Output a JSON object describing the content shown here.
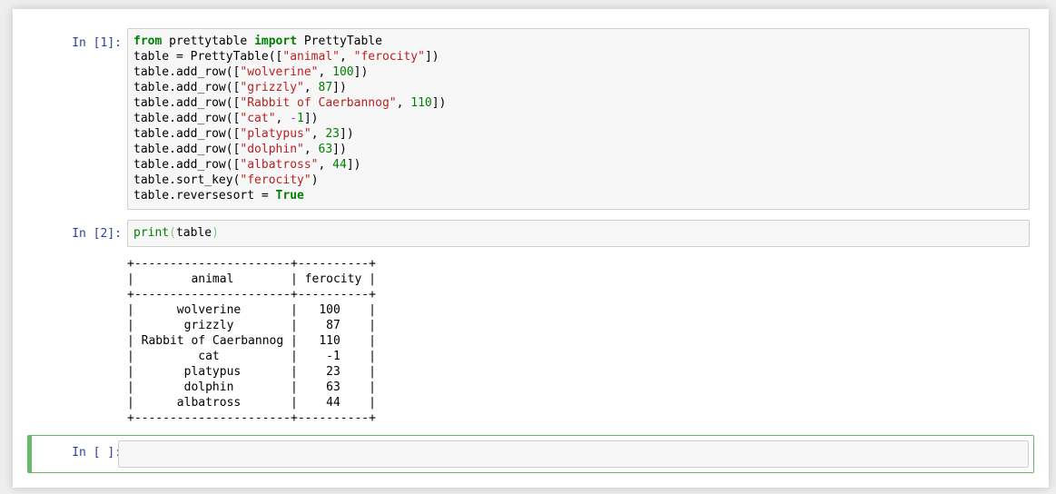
{
  "cells": [
    {
      "prompt": "In [1]:",
      "lines": [
        [
          {
            "t": "from",
            "c": "kw"
          },
          {
            "t": " prettytable ",
            "c": ""
          },
          {
            "t": "import",
            "c": "kw"
          },
          {
            "t": " PrettyTable",
            "c": ""
          }
        ],
        [
          {
            "t": "table = PrettyTable([",
            "c": ""
          },
          {
            "t": "\"animal\"",
            "c": "str"
          },
          {
            "t": ", ",
            "c": ""
          },
          {
            "t": "\"ferocity\"",
            "c": "str"
          },
          {
            "t": "])",
            "c": ""
          }
        ],
        [
          {
            "t": "table.add_row([",
            "c": ""
          },
          {
            "t": "\"wolverine\"",
            "c": "str"
          },
          {
            "t": ", ",
            "c": ""
          },
          {
            "t": "100",
            "c": "num"
          },
          {
            "t": "])",
            "c": ""
          }
        ],
        [
          {
            "t": "table.add_row([",
            "c": ""
          },
          {
            "t": "\"grizzly\"",
            "c": "str"
          },
          {
            "t": ", ",
            "c": ""
          },
          {
            "t": "87",
            "c": "num"
          },
          {
            "t": "])",
            "c": ""
          }
        ],
        [
          {
            "t": "table.add_row([",
            "c": ""
          },
          {
            "t": "\"Rabbit of Caerbannog\"",
            "c": "str"
          },
          {
            "t": ", ",
            "c": ""
          },
          {
            "t": "110",
            "c": "num"
          },
          {
            "t": "])",
            "c": ""
          }
        ],
        [
          {
            "t": "table.add_row([",
            "c": ""
          },
          {
            "t": "\"cat\"",
            "c": "str"
          },
          {
            "t": ", ",
            "c": ""
          },
          {
            "t": "-",
            "c": "op"
          },
          {
            "t": "1",
            "c": "num"
          },
          {
            "t": "])",
            "c": ""
          }
        ],
        [
          {
            "t": "table.add_row([",
            "c": ""
          },
          {
            "t": "\"platypus\"",
            "c": "str"
          },
          {
            "t": ", ",
            "c": ""
          },
          {
            "t": "23",
            "c": "num"
          },
          {
            "t": "])",
            "c": ""
          }
        ],
        [
          {
            "t": "table.add_row([",
            "c": ""
          },
          {
            "t": "\"dolphin\"",
            "c": "str"
          },
          {
            "t": ", ",
            "c": ""
          },
          {
            "t": "63",
            "c": "num"
          },
          {
            "t": "])",
            "c": ""
          }
        ],
        [
          {
            "t": "table.add_row([",
            "c": ""
          },
          {
            "t": "\"albatross\"",
            "c": "str"
          },
          {
            "t": ", ",
            "c": ""
          },
          {
            "t": "44",
            "c": "num"
          },
          {
            "t": "])",
            "c": ""
          }
        ],
        [
          {
            "t": "table.sort_key(",
            "c": ""
          },
          {
            "t": "\"ferocity\"",
            "c": "str"
          },
          {
            "t": ")",
            "c": ""
          }
        ],
        [
          {
            "t": "table.reversesort = ",
            "c": ""
          },
          {
            "t": "True",
            "c": "kw"
          }
        ]
      ]
    },
    {
      "prompt": "In [2]:",
      "lines": [
        [
          {
            "t": "print",
            "c": "bi"
          },
          {
            "t": "(",
            "c": "paren"
          },
          {
            "t": "table",
            "c": ""
          },
          {
            "t": ")",
            "c": "paren"
          }
        ]
      ]
    },
    {
      "prompt": "In [ ]:",
      "lines": []
    }
  ],
  "output": {
    "border": "+----------------------+----------+",
    "header": "|        animal        | ferocity |",
    "rows": [
      "|      wolverine       |   100    |",
      "|       grizzly        |    87    |",
      "| Rabbit of Caerbannog |   110    |",
      "|         cat          |    -1    |",
      "|       platypus       |    23    |",
      "|       dolphin        |    63    |",
      "|      albatross       |    44    |"
    ],
    "table": {
      "columns": [
        "animal",
        "ferocity"
      ],
      "rows": [
        [
          "wolverine",
          100
        ],
        [
          "grizzly",
          87
        ],
        [
          "Rabbit of Caerbannog",
          110
        ],
        [
          "cat",
          -1
        ],
        [
          "platypus",
          23
        ],
        [
          "dolphin",
          63
        ],
        [
          "albatross",
          44
        ]
      ]
    }
  },
  "colors": {
    "prompt": "#303F9F",
    "keyword": "#008000",
    "string": "#BA2121",
    "selected_cell_border": "#66BB6A"
  }
}
